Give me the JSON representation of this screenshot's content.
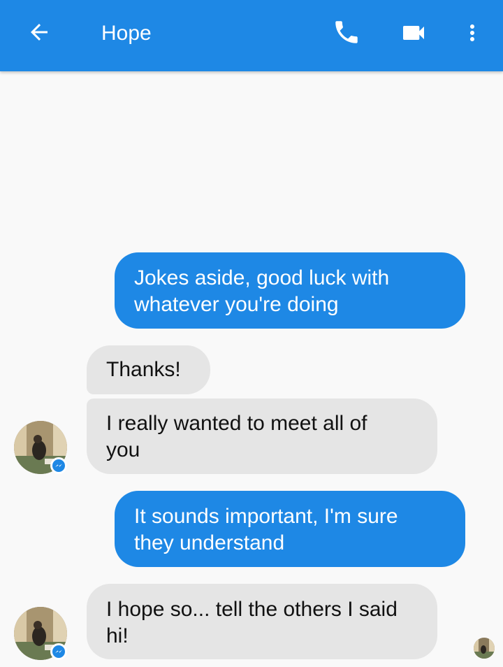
{
  "header": {
    "title": "Hope",
    "icons": [
      "back-arrow-icon",
      "phone-icon",
      "video-camera-icon",
      "more-vert-icon"
    ],
    "color": "#1e88e5"
  },
  "messages": [
    {
      "direction": "outgoing",
      "text": "Jokes aside, good luck with\nwhatever you're doing"
    },
    {
      "direction": "incoming",
      "text": "Thanks!"
    },
    {
      "direction": "incoming",
      "text": "I really wanted to meet all of\nyou"
    },
    {
      "direction": "outgoing",
      "text": "It sounds important, I'm sure\nthey understand"
    },
    {
      "direction": "incoming",
      "text": "I hope so... tell the others I said\nhi!"
    }
  ],
  "colors": {
    "outgoing_bubble": "#1e88e5",
    "incoming_bubble": "#e5e5e5",
    "background": "#f9f9f9"
  }
}
